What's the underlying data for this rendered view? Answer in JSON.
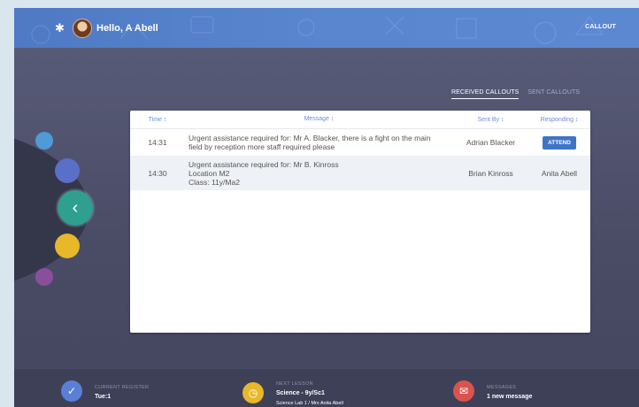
{
  "header": {
    "greeting": "Hello, A Abell",
    "callout_link": "CALLOUT"
  },
  "tabs": [
    {
      "label": "RECEIVED CALLOUTS",
      "active": true
    },
    {
      "label": "SENT CALLOUTS",
      "active": false
    }
  ],
  "table": {
    "columns": {
      "time": "Time ↕",
      "message": "Message ↕",
      "sent_by": "Sent By ↕",
      "responding": "Responding ↕"
    },
    "rows": [
      {
        "time": "14:31",
        "message_lines": [
          "Urgent assistance required for: Mr A. Blacker, there is a fight on the main",
          "field by reception more staff required please"
        ],
        "sent_by": "Adrian Blacker",
        "responding": "ATTEND"
      },
      {
        "time": "14:30",
        "message_lines": [
          "Urgent assistance required for: Mr B. Kinross",
          "Location M2",
          "Class: 11y/Ma2"
        ],
        "sent_by": "Brian Kinross",
        "responding": "Anita Abell"
      }
    ]
  },
  "footer": {
    "register": {
      "label": "CURRENT REGISTER",
      "value": "Tue:1",
      "color": "#5b7fd6"
    },
    "next_lesson": {
      "label": "NEXT LESSON",
      "value": "Science - 9y/Sc1",
      "sub": "Science Lab 1 / Mrs Anita Abell",
      "color": "#e6b82a"
    },
    "messages": {
      "label": "MESSAGES",
      "value": "1 new message",
      "color": "#d9534f"
    }
  },
  "icons": {
    "settings": "gear-icon",
    "back": "chevron-left-icon"
  }
}
